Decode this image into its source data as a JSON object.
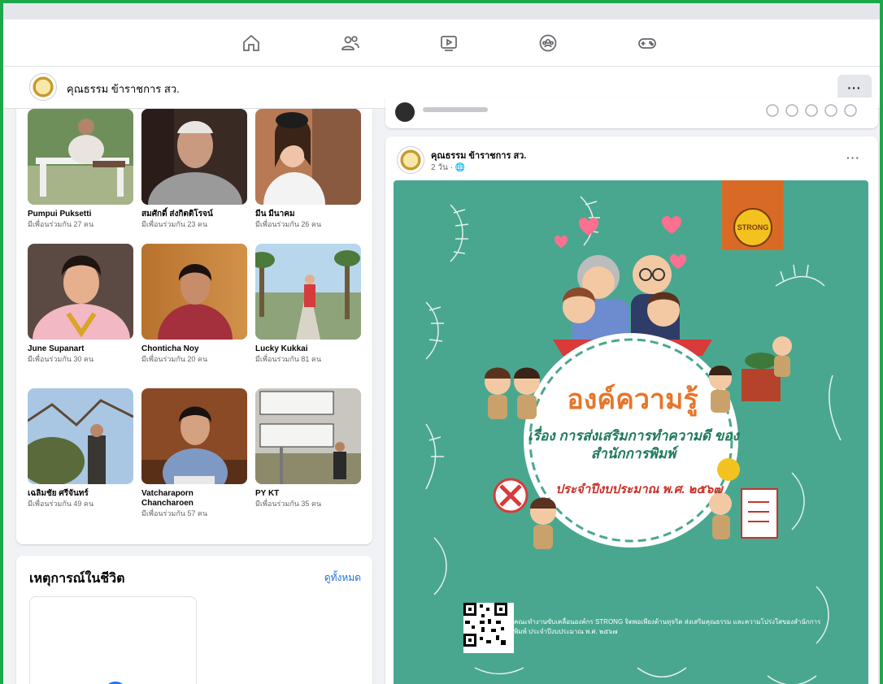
{
  "page": {
    "name": "คุณธรรม ข้าราชการ สว.",
    "more_label": "···"
  },
  "friends": [
    {
      "name": "Pumpui Puksetti",
      "mutual": "มีเพื่อนร่วมกัน 27 คน"
    },
    {
      "name": "สมศักดิ์ ส่งกิตติโรจน์",
      "mutual": "มีเพื่อนร่วมกัน 23 คน"
    },
    {
      "name": "มีน มีนาคม",
      "mutual": "มีเพื่อนร่วมกัน 26 คน"
    },
    {
      "name": "June Supanart",
      "mutual": "มีเพื่อนร่วมกัน 30 คน"
    },
    {
      "name": "Chonticha Noy",
      "mutual": "มีเพื่อนร่วมกัน 20 คน"
    },
    {
      "name": "Lucky Kukkai",
      "mutual": "มีเพื่อนร่วมกัน 81 คน"
    },
    {
      "name": "เฉลิมชัย ศรีจันทร์",
      "mutual": "มีเพื่อนร่วมกัน 49 คน"
    },
    {
      "name": "Vatcharaporn Chancharoen",
      "mutual": "มีเพื่อนร่วมกัน 57 คน"
    },
    {
      "name": "PY KT",
      "mutual": "มีเพื่อนร่วมกัน 35 คน"
    }
  ],
  "life_events": {
    "title": "เหตุการณ์ในชีวิต",
    "see_all": "ดูทั้งหมด"
  },
  "post": {
    "author": "คุณธรรม ข้าราชการ สว.",
    "meta": "2 วัน · 🌐",
    "more_label": "···",
    "poster": {
      "title": "องค์ความรู้",
      "subtitle": "เรื่อง การส่งเสริมการทำความดี ของสำนักการพิมพ์",
      "year": "ประจำปีงบประมาณ พ.ศ. ๒๕๖๗",
      "badge": "STRONG",
      "footer": "คณะทำงานขับเคลื่อนองค์กร STRONG จิตพอเพียงต้านทุจริต ส่งเสริมคุณธรรม และความโปร่งใสของสำนักการพิมพ์ ประจำปีงบประมาณ พ.ศ. ๒๕๖๗"
    }
  },
  "nav_icons": [
    "home-icon",
    "friends-icon",
    "watch-icon",
    "groups-icon",
    "gaming-icon"
  ],
  "colors": {
    "accent": "#1877f2",
    "poster_bg": "#4aa78f",
    "frame": "#1ba84a"
  }
}
